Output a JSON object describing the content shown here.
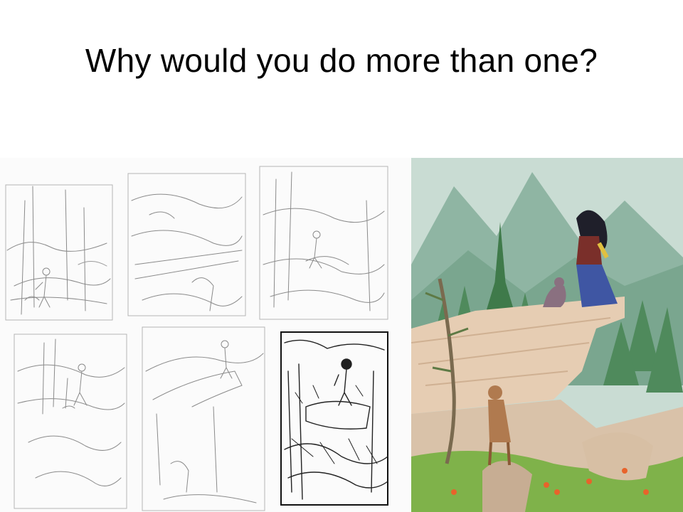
{
  "slide": {
    "title": "Why would you do more than one?"
  },
  "figures": {
    "sketch_sheet": {
      "thumbnail_count": 6,
      "final_inked_sketch": 1
    },
    "painting": {
      "subject": "woman-on-cliff-with-goats"
    }
  },
  "colors": {
    "sky": "#c9dcd3",
    "mountains": "#8fb5a3",
    "pine": "#3f7a4a",
    "rock": "#e6cdb3",
    "grass": "#7fb24a",
    "dress": "#3f56a3"
  }
}
